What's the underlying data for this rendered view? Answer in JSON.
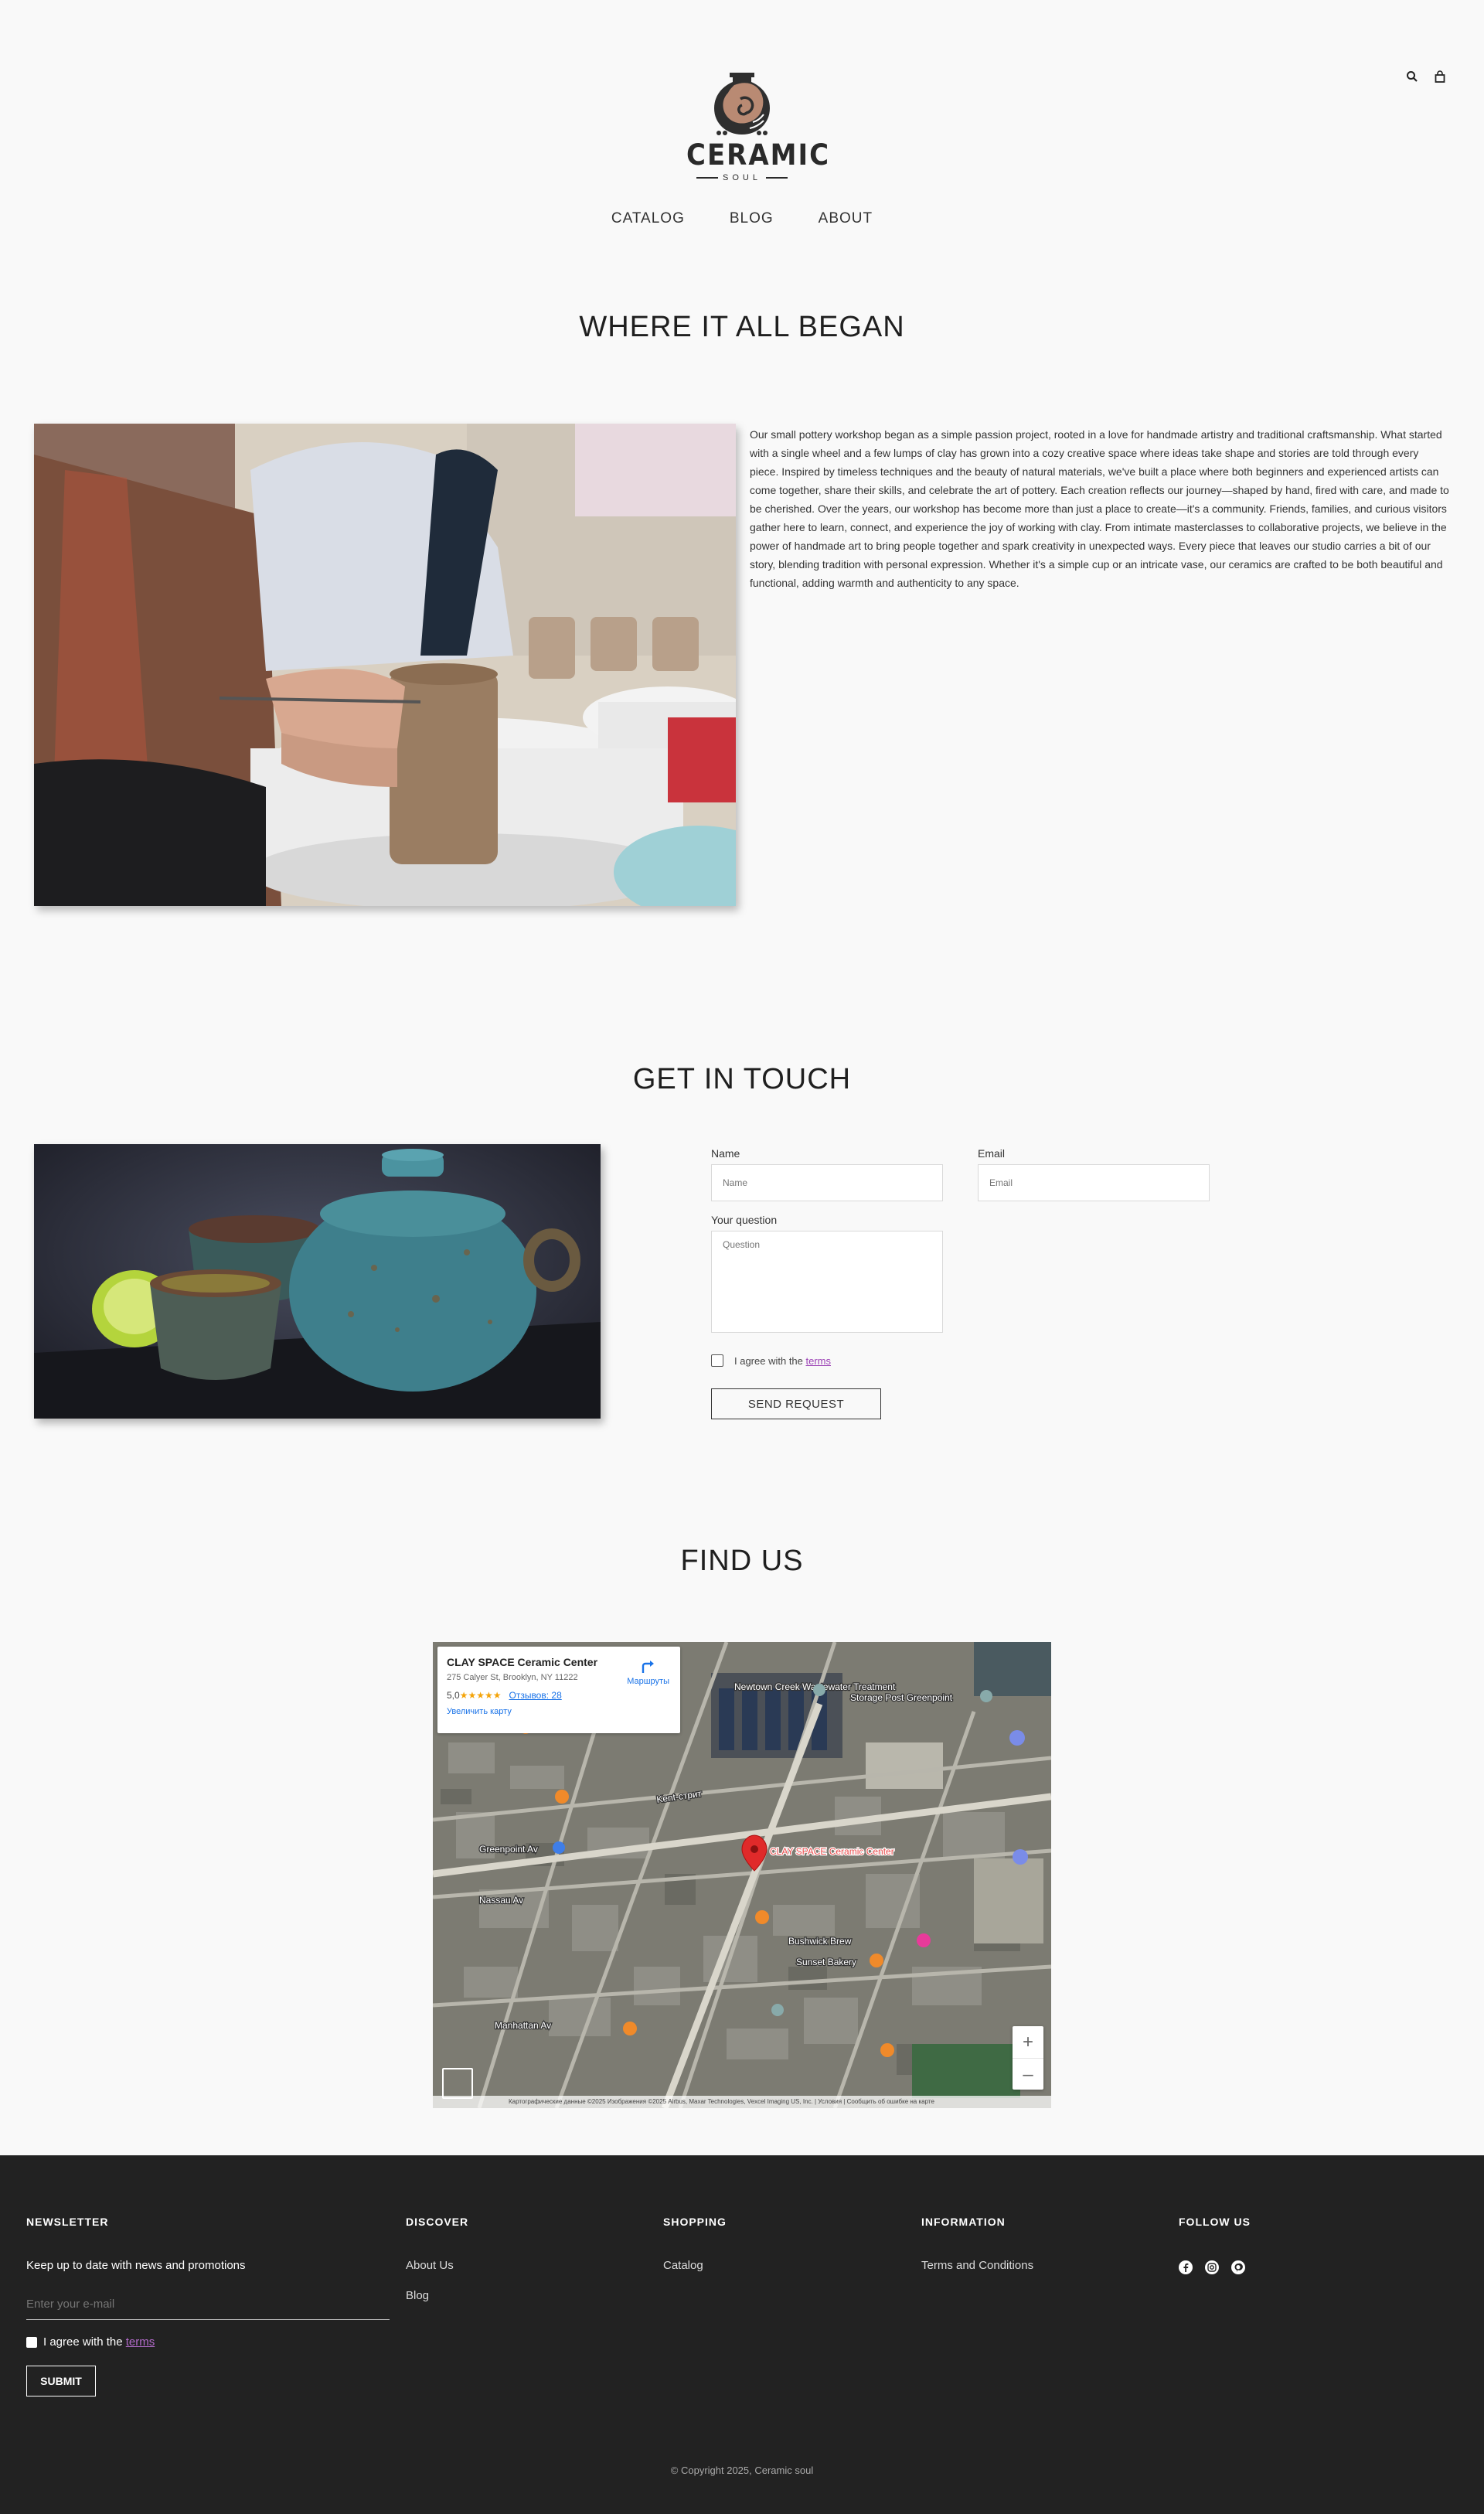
{
  "header": {
    "brand": "CERAMIC",
    "brand_sub": "SOUL",
    "nav": [
      "CATALOG",
      "BLOG",
      "ABOUT"
    ],
    "icons": [
      "search-icon",
      "bag-icon"
    ]
  },
  "story": {
    "title": "WHERE IT ALL BEGAN",
    "text": "Our small pottery workshop began as a simple passion project, rooted in a love for handmade artistry and traditional craftsmanship. What started with a single wheel and a few lumps of clay has grown into a cozy creative space where ideas take shape and stories are told through every piece. Inspired by timeless techniques and the beauty of natural materials, we've built a place where both beginners and experienced artists can come together, share their skills, and celebrate the art of pottery. Each creation reflects our journey—shaped by hand, fired with care, and made to be cherished. Over the years, our workshop has become more than just a place to create—it's a community. Friends, families, and curious visitors gather here to learn, connect, and experience the joy of working with clay. From intimate masterclasses to collaborative projects, we believe in the power of handmade art to bring people together and spark creativity in unexpected ways. Every piece that leaves our studio carries a bit of our story, blending tradition with personal expression. Whether it's a simple cup or an intricate vase, our ceramics are crafted to be both beautiful and functional, adding warmth and authenticity to any space."
  },
  "contact": {
    "title": "GET IN TOUCH",
    "name_label": "Name",
    "name_placeholder": "Name",
    "email_label": "Email",
    "email_placeholder": "Email",
    "question_label": "Your question",
    "question_placeholder": "Question",
    "agree_prefix": "I agree with the ",
    "agree_terms": "terms",
    "send_label": "SEND REQUEST"
  },
  "map": {
    "title": "FIND US",
    "place_name": "CLAY SPACE Ceramic Center",
    "address": "275 Calyer St, Brooklyn, NY 11222",
    "rating": "5,0",
    "stars": "★★★★★",
    "reviews": "Отзывов: 28",
    "enlarge": "Увеличить карту",
    "route": "Маршруты",
    "marker_label": "CLAY SPACE Ceramic Center",
    "footer_text": "Картографические данные ©2025 Изображения ©2025 Airbus, Maxar Technologies, Vexcel Imaging US, Inc. | Условия | Сообщить об ошибке на карте",
    "zoom_in": "+",
    "zoom_out": "–",
    "labels": [
      "Newtown Creek Wastewater Treatment",
      "Storage Post Greenpoint",
      "Kent-стрит",
      "Greenpoint Av",
      "Nassau Av",
      "Bushwick Brew",
      "Sunset Bakery",
      "Manhattan Av"
    ]
  },
  "footer": {
    "newsletter_head": "NEWSLETTER",
    "newsletter_text": "Keep up to date with news and promotions",
    "email_placeholder": "Enter your e-mail",
    "agree_prefix": "I agree with the ",
    "agree_terms": "terms",
    "submit_label": "SUBMIT",
    "discover_head": "DISCOVER",
    "discover_links": [
      "About Us",
      "Blog"
    ],
    "shopping_head": "SHOPPING",
    "shopping_links": [
      "Catalog"
    ],
    "info_head": "INFORMATION",
    "info_links": [
      "Terms and Conditions"
    ],
    "follow_head": "FOLLOW US",
    "social_icons": [
      "facebook-icon",
      "instagram-icon",
      "pinterest-icon"
    ],
    "copyright": "© Copyright 2025, Ceramic soul"
  },
  "colors": {
    "background": "#f9f9f9",
    "footer": "#222222",
    "accent": "#9a3fb4"
  }
}
